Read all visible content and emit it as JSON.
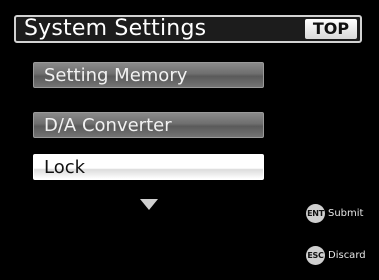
{
  "header": {
    "title": "System Settings",
    "top_button": "TOP"
  },
  "menu": {
    "items": [
      {
        "label": "Setting Memory",
        "selected": false
      },
      {
        "label": "D/A Converter",
        "selected": false
      },
      {
        "label": "Lock",
        "selected": true
      }
    ]
  },
  "hints": {
    "submit": {
      "key": "ENT",
      "label": "Submit"
    },
    "discard": {
      "key": "ESC",
      "label": "Discard"
    }
  },
  "icons": {
    "scroll_indicator": "down-arrow-icon"
  },
  "colors": {
    "background": "#000000",
    "selected_item": "#ffffff",
    "unselected_item": "#737373"
  }
}
